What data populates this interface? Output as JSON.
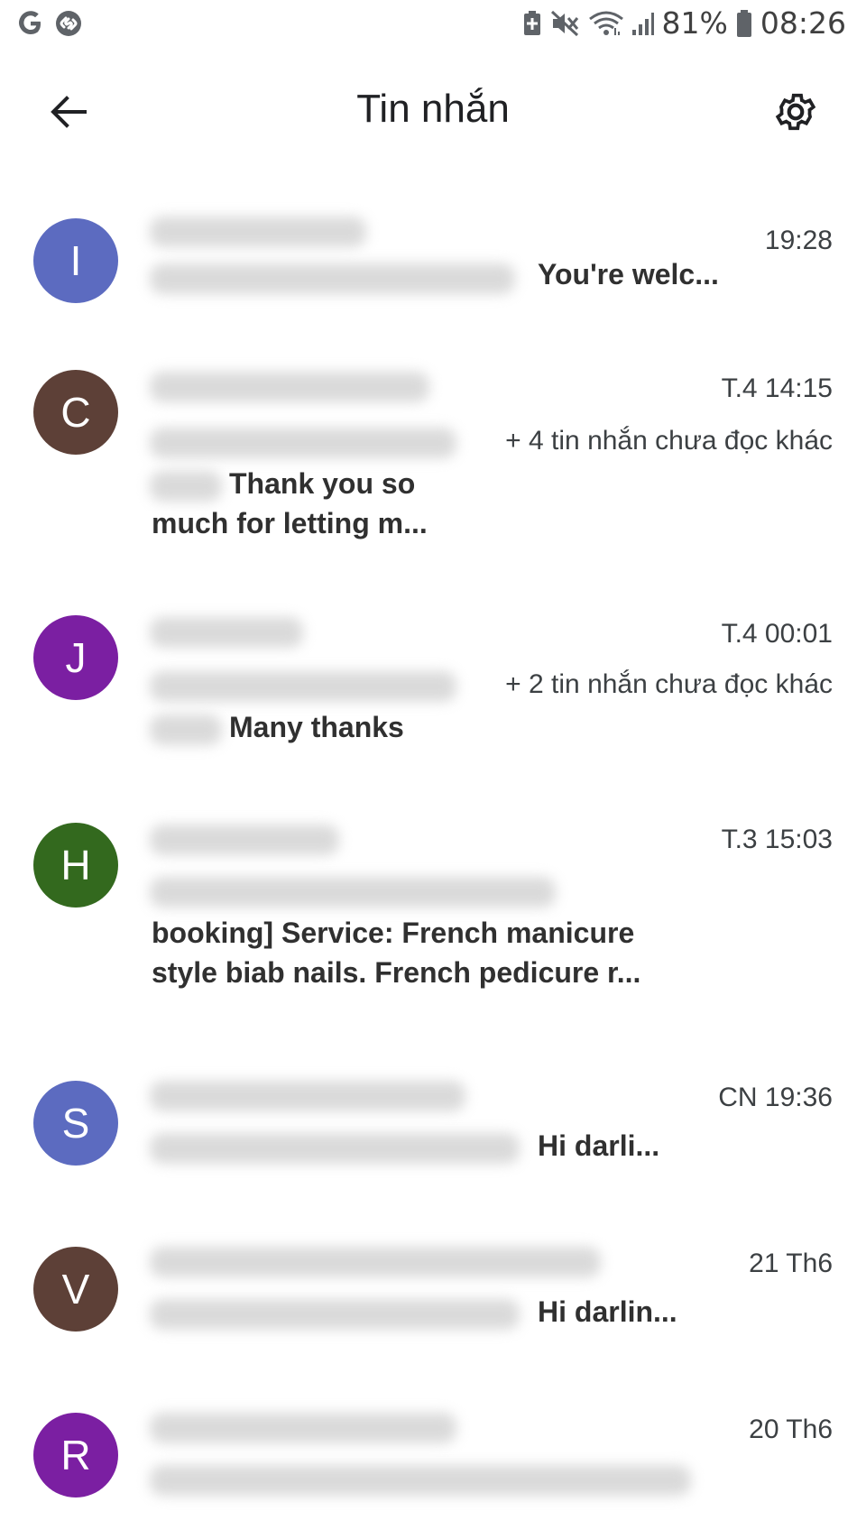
{
  "status_bar": {
    "battery_percent": "81%",
    "time": "08:26",
    "left_icons": [
      "google-icon",
      "shazam-icon"
    ],
    "right_icons": [
      "battery-saver-icon",
      "mute-icon",
      "wifi-icon",
      "signal-icon",
      "battery-icon"
    ]
  },
  "header": {
    "title": "Tin nhắn",
    "back_icon": "back-arrow-icon",
    "settings_icon": "gear-icon"
  },
  "conversations": [
    {
      "initial": "I",
      "color": "#5c6bc0",
      "time": "19:28",
      "unread_note": "",
      "snippet": "You're welc..."
    },
    {
      "initial": "C",
      "color": "#5d4037",
      "time": "T.4 14:15",
      "unread_note": "+ 4 tin nhắn chưa đọc khác",
      "snippet_line1": "Thank you so",
      "snippet_line2": "much for letting m..."
    },
    {
      "initial": "J",
      "color": "#7b1fa2",
      "time": "T.4 00:01",
      "unread_note": "+ 2 tin nhắn chưa đọc khác",
      "snippet": "Many thanks"
    },
    {
      "initial": "H",
      "color": "#33691e",
      "time": "T.3 15:03",
      "unread_note": "",
      "snippet_line1": "booking] Service: French manicure",
      "snippet_line2": "style biab nails. French pedicure r..."
    },
    {
      "initial": "S",
      "color": "#5c6bc0",
      "time": "CN 19:36",
      "unread_note": "",
      "snippet": "Hi darli..."
    },
    {
      "initial": "V",
      "color": "#5d4037",
      "time": "21 Th6",
      "unread_note": "",
      "snippet": "Hi darlin..."
    },
    {
      "initial": "R",
      "color": "#7b1fa2",
      "time": "20 Th6",
      "unread_note": "",
      "snippet": ""
    }
  ]
}
